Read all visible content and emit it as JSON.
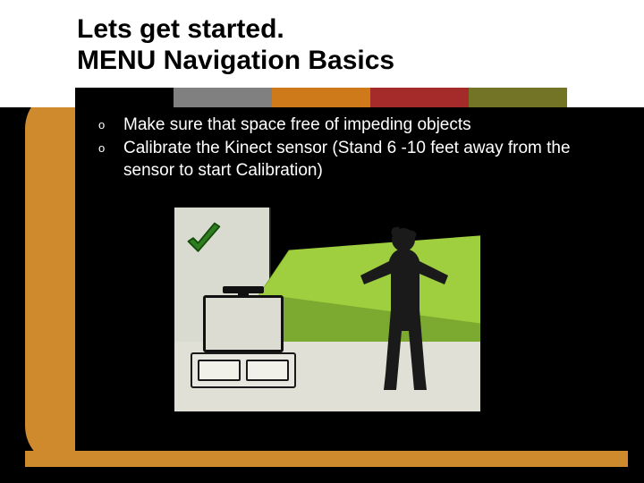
{
  "title_line1": "Lets get started.",
  "title_line2": "MENU Navigation Basics",
  "bullets": [
    "Make sure that space free of impeding objects",
    "Calibrate the Kinect sensor (Stand 6 -10 feet away from the sensor to start Calibration)"
  ],
  "tab_colors": [
    "#000000",
    "#808080",
    "#cf7a1a",
    "#a52a2a",
    "#747427"
  ],
  "accent_rail": "#d08a2e",
  "illustration": {
    "has_checkmark": true,
    "checkmark_color": "#2e7d1f",
    "elements": [
      "tv",
      "kinect-sensor",
      "cabinet",
      "person-silhouette",
      "play-space-beam"
    ]
  }
}
